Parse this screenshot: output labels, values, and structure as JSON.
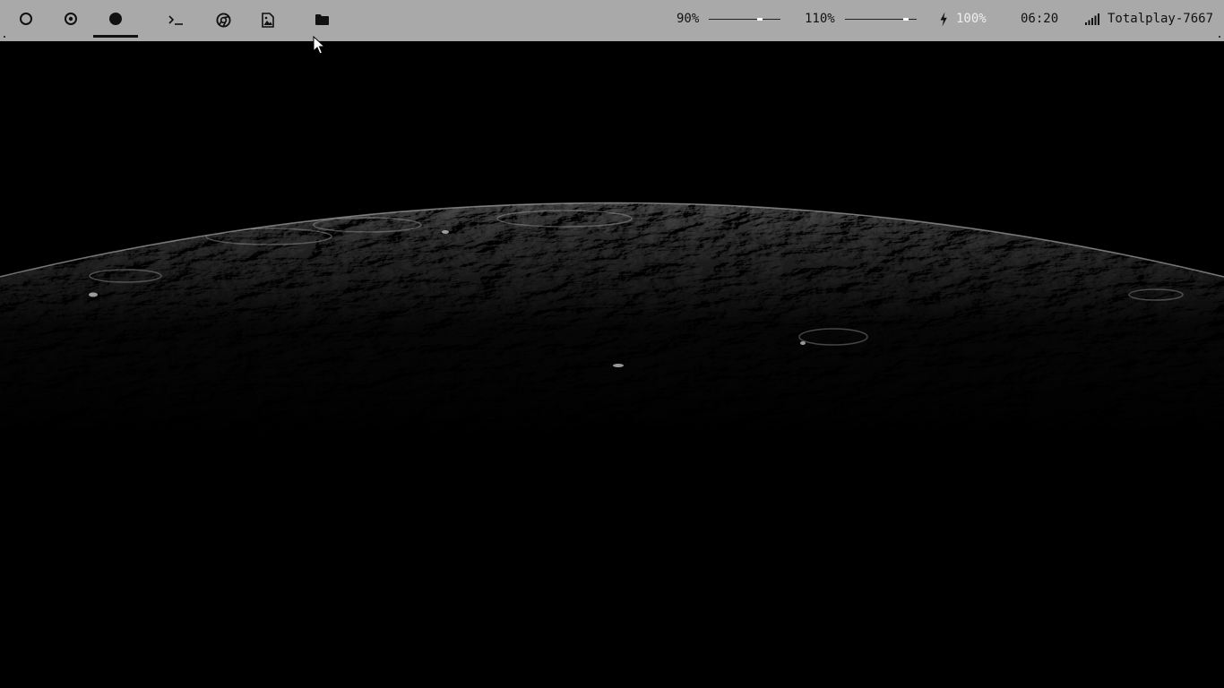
{
  "workspaces": [
    {
      "name": "workspace-1",
      "icon": "circle-outline-icon",
      "active": false
    },
    {
      "name": "workspace-2",
      "icon": "circle-dot-icon",
      "active": false
    },
    {
      "name": "workspace-3",
      "icon": "circle-filled-icon",
      "active": true
    }
  ],
  "apps": [
    {
      "name": "terminal",
      "icon": "terminal-icon"
    },
    {
      "name": "chrome",
      "icon": "chrome-icon"
    },
    {
      "name": "image-viewer",
      "icon": "image-file-icon"
    },
    {
      "name": "file-manager",
      "icon": "folder-icon"
    }
  ],
  "indicators": {
    "volume": {
      "label": "90%",
      "level": 0.9
    },
    "brightness": {
      "label": "110%",
      "level": 1.1
    },
    "battery": {
      "icon": "lightning-icon",
      "label": "100%"
    },
    "clock": "06:20",
    "wifi": {
      "icon": "wifi-signal-icon",
      "network": "Totalplay-7667"
    }
  },
  "colors": {
    "bar_background": "#a9a9a9",
    "bar_text": "#111111",
    "battery_text": "#eeeeee",
    "desktop_background": "#000000"
  },
  "wallpaper": {
    "subject": "moon-surface-horizon"
  }
}
